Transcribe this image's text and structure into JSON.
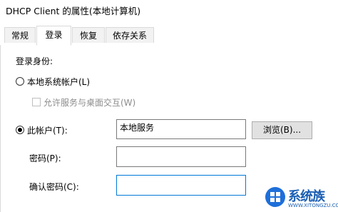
{
  "window": {
    "title": "DHCP Client 的属性(本地计算机)"
  },
  "tabs": [
    {
      "label": "常规",
      "active": false
    },
    {
      "label": "登录",
      "active": true
    },
    {
      "label": "恢复",
      "active": false
    },
    {
      "label": "依存关系",
      "active": false
    }
  ],
  "logon": {
    "section_label": "登录身份:",
    "local_system_label": "本地系统帐户(L)",
    "local_system_selected": false,
    "interact_desktop_label": "允许服务与桌面交互(W)",
    "interact_desktop_checked": false,
    "this_account_label": "此帐户(T):",
    "this_account_selected": true,
    "account_value": "本地服务",
    "browse_label": "浏览(B)...",
    "password_label": "密码(P):",
    "password_value": "",
    "confirm_password_label": "确认密码(C):",
    "confirm_password_value": ""
  },
  "watermark": {
    "name": "系统族",
    "url": "WWW.XITONGZU.COM"
  }
}
